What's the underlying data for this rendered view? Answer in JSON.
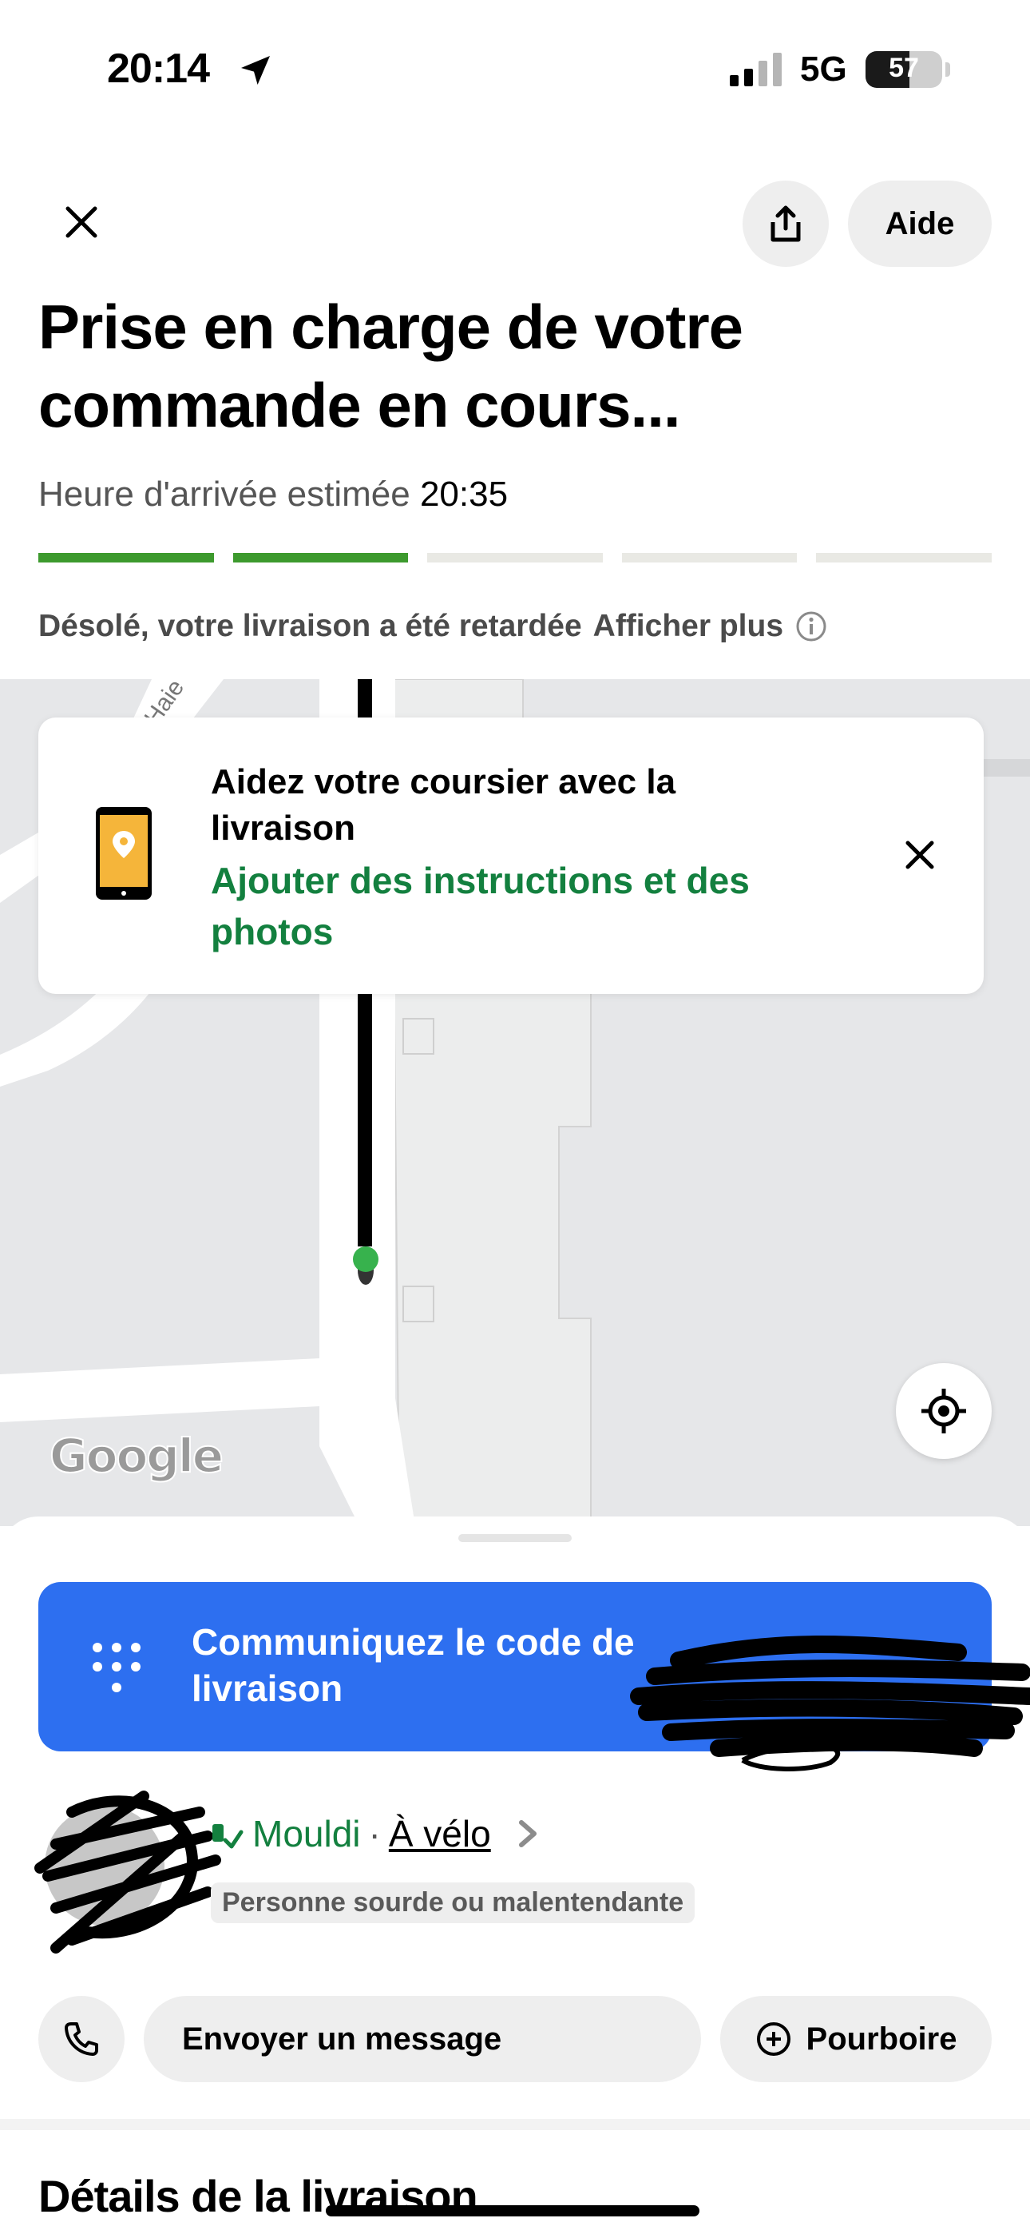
{
  "status_bar": {
    "time": "20:14",
    "network": "5G",
    "battery": "57",
    "battery_level": 0.57
  },
  "header": {
    "close_icon": "close-icon",
    "share_icon": "share-icon",
    "help_label": "Aide",
    "title": "Prise en charge de votre commande en cours...",
    "eta_label": "Heure d'arrivée estimée",
    "eta_time": "20:35",
    "progress_steps_total": 5,
    "progress_steps_done": 2,
    "delay_text": "Désolé, votre livraison a été retardée",
    "show_more": "Afficher plus"
  },
  "map": {
    "attribution": "Google",
    "street_fragment": "Haie"
  },
  "instruction_card": {
    "title": "Aidez votre coursier avec la livraison",
    "link": "Ajouter des instructions et des photos"
  },
  "sheet": {
    "code_button_label": "Communiquez le code de livraison",
    "courier": {
      "name": "Mouldi",
      "separator": "·",
      "vehicle": "À vélo",
      "badge": "Personne sourde ou malentendante"
    },
    "actions": {
      "message": "Envoyer un message",
      "tip": "Pourboire"
    },
    "details_title": "Détails de la livraison"
  },
  "colors": {
    "accent_green": "#13803f",
    "progress_green": "#3d9a2e",
    "code_blue": "#2d6ff0"
  }
}
